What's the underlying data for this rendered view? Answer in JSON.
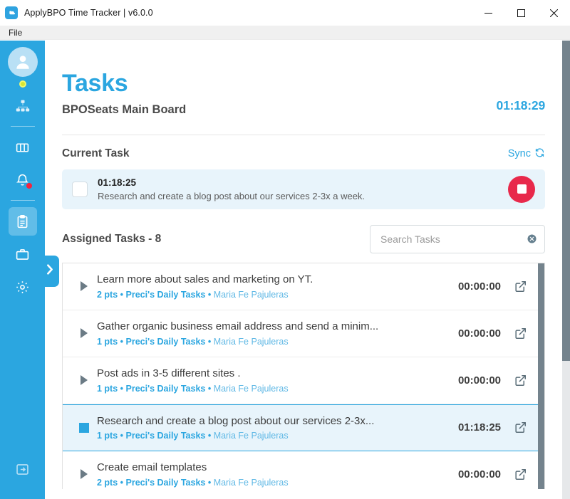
{
  "window": {
    "title": "ApplyBPO Time Tracker | v6.0.0",
    "app_icon": "cloud-icon",
    "minimize_label": "Minimize",
    "maximize_label": "Maximize",
    "close_label": "Close",
    "accent_color": "#2ba6e0"
  },
  "menubar": {
    "items": [
      {
        "label": "File"
      }
    ]
  },
  "sidebar": {
    "background_color": "#2ba6e0",
    "avatar": "person-avatar-icon",
    "status": {
      "name": "status-dot",
      "color": "#d8e632"
    },
    "items": [
      {
        "name": "org-chart-icon",
        "label": "Organization"
      },
      {
        "name": "kanban-board-icon",
        "label": "Board"
      },
      {
        "name": "bell-icon",
        "label": "Notifications",
        "badge": true
      },
      {
        "name": "clipboard-icon",
        "label": "Tasks",
        "active": true
      },
      {
        "name": "briefcase-icon",
        "label": "Work"
      },
      {
        "name": "gear-icon",
        "label": "Settings"
      }
    ],
    "logout": {
      "name": "logout-icon",
      "label": "Logout"
    },
    "expand": {
      "name": "chevron-right-icon",
      "label": "Expand sidebar"
    }
  },
  "header": {
    "title": "Tasks",
    "subtitle": "BPOSeats Main Board",
    "timer": "01:18:29"
  },
  "current_task": {
    "section_label": "Current Task",
    "sync_label": "Sync",
    "sync_icon": "refresh-icon",
    "checkbox_checked": false,
    "time": "01:18:25",
    "description": "Research and create a blog post about our services 2-3x a week.",
    "stop_button": {
      "label": "Stop",
      "color": "#e8294b"
    }
  },
  "assigned": {
    "title": "Assigned Tasks - 8",
    "count": 8,
    "search": {
      "placeholder": "Search Tasks",
      "value": "",
      "clear_icon": "clear-circle-icon"
    },
    "tasks": [
      {
        "title": "Learn more about sales and marketing on YT.",
        "points": "2 pts",
        "project": "Preci's Daily Tasks",
        "assignee": "Maria Fe Pajuleras",
        "time": "00:00:00",
        "running": false
      },
      {
        "title": "Gather organic business email address and send a minim...",
        "points": "1 pts",
        "project": "Preci's Daily Tasks",
        "assignee": "Maria Fe Pajuleras",
        "time": "00:00:00",
        "running": false
      },
      {
        "title": "Post ads in 3-5 different sites .",
        "points": "1 pts",
        "project": "Preci's Daily Tasks",
        "assignee": "Maria Fe Pajuleras",
        "time": "00:00:00",
        "running": false
      },
      {
        "title": "Research and create a blog post about our services 2-3x...",
        "points": "1 pts",
        "project": "Preci's Daily Tasks",
        "assignee": "Maria Fe Pajuleras",
        "time": "01:18:25",
        "running": true
      },
      {
        "title": "Create email templates",
        "points": "2 pts",
        "project": "Preci's Daily Tasks",
        "assignee": "Maria Fe Pajuleras",
        "time": "00:00:00",
        "running": false
      }
    ],
    "separator": "•"
  }
}
